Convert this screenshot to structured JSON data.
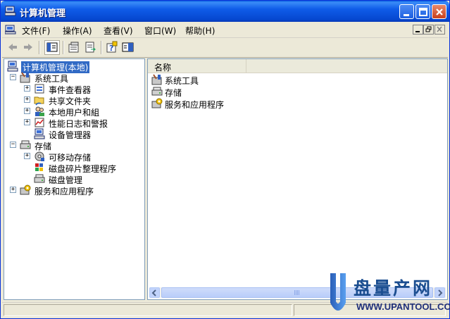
{
  "window": {
    "title": "计算机管理",
    "controls": [
      "minimize-icon",
      "maximize-icon",
      "close-icon"
    ]
  },
  "menubar": {
    "items": [
      {
        "label": "文件(F)"
      },
      {
        "label": "操作(A)"
      },
      {
        "label": "查看(V)"
      },
      {
        "label": "窗口(W)"
      },
      {
        "label": "帮助(H)"
      }
    ]
  },
  "toolbar": {
    "buttons": [
      "back-arrow-icon",
      "forward-arrow-icon",
      "show-hide-tree-icon",
      "properties-icon",
      "export-list-icon",
      "help-icon",
      "console-view-icon"
    ]
  },
  "tree": {
    "root": "计算机管理(本地)",
    "nodes": [
      {
        "label": "系统工具",
        "expander": "⊟"
      },
      {
        "label": "事件查看器",
        "expander": "⊞"
      },
      {
        "label": "共享文件夹",
        "expander": "⊞"
      },
      {
        "label": "本地用户和組",
        "expander": "⊞"
      },
      {
        "label": "性能日志和警报",
        "expander": "⊞"
      },
      {
        "label": "设备管理器",
        "expander": ""
      },
      {
        "label": "存储",
        "expander": "⊟"
      },
      {
        "label": "可移动存储",
        "expander": "⊞"
      },
      {
        "label": "磁盘碎片整理程序",
        "expander": ""
      },
      {
        "label": "磁盘管理",
        "expander": ""
      },
      {
        "label": "服务和应用程序",
        "expander": "⊞"
      }
    ]
  },
  "list": {
    "column_header": "名称",
    "rows": [
      {
        "label": "系统工具"
      },
      {
        "label": "存储"
      },
      {
        "label": "服务和应用程序"
      }
    ]
  },
  "watermark": {
    "title": "盘量产网",
    "url": "WWW.UPANTOOL.COM"
  },
  "colors": {
    "title_bar": "#0f5ce8",
    "selection": "#316ac5",
    "window_face": "#ece9d8"
  }
}
